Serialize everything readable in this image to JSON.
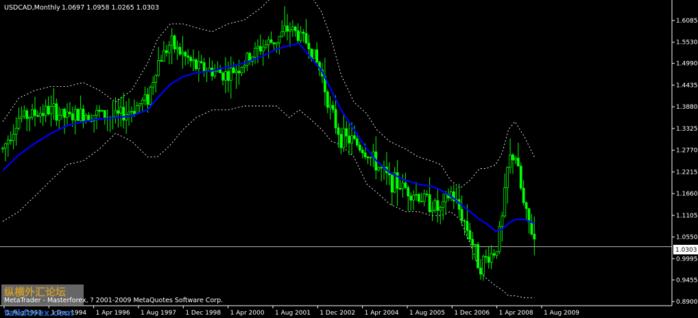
{
  "header": {
    "symbol_tf": "USDCAD,Monthly",
    "ohlc": "1.0697 1.0958 1.0265 1.0303"
  },
  "footer": {
    "copyright": "MetaTrader - Masterforex, ? 2001-2009 MetaQuotes Software Corp.",
    "watermark_cn": "纵横外汇论坛",
    "watermark_site": "talkforex.com"
  },
  "colors": {
    "background": "#000000",
    "axis": "#ffffff",
    "candles": "#00ff00",
    "ma": "#0000ff",
    "bands": "#ffffff",
    "price_line": "#ffffff",
    "current_label_bg": "#ffffff"
  },
  "chart_data": {
    "type": "line",
    "subtype": "candlestick with moving average and envelope bands",
    "title": "USDCAD,Monthly",
    "current_price": 1.0303,
    "price_axis": {
      "ticks": [
        "1.6085",
        "1.5530",
        "1.4990",
        "1.4435",
        "1.3880",
        "1.3325",
        "1.2770",
        "1.2215",
        "1.1660",
        "1.1105",
        "1.0550",
        "0.9995",
        "0.9455",
        "0.8900"
      ],
      "current_label": "1.0303"
    },
    "time_axis": {
      "ticks": [
        "1 Aug 1993",
        "1 Dec 1994",
        "1 Apr 1996",
        "1 Aug 1997",
        "1 Dec 1998",
        "1 Apr 2000",
        "1 Aug 2001",
        "1 Dec 2002",
        "1 Apr 2004",
        "1 Aug 2005",
        "1 Dec 2006",
        "1 Apr 2008",
        "1 Aug 2009"
      ]
    },
    "ylim": [
      0.89,
      1.6085
    ],
    "x": [
      1993.0,
      1993.5,
      1994.0,
      1994.5,
      1995.0,
      1995.5,
      1996.0,
      1996.5,
      1997.0,
      1997.5,
      1997.8,
      1998.2,
      1998.6,
      1999.0,
      1999.5,
      2000.0,
      2000.5,
      2001.0,
      2001.5,
      2001.9,
      2002.2,
      2002.5,
      2002.9,
      2003.2,
      2003.5,
      2003.9,
      2004.3,
      2004.6,
      2005.0,
      2005.5,
      2005.9,
      2006.3,
      2006.6,
      2006.9,
      2007.2,
      2007.5,
      2007.8,
      2008.0,
      2008.3,
      2008.5,
      2008.7,
      2008.9,
      2009.2,
      2009.5
    ],
    "series": [
      {
        "values": [
          1.28,
          1.36,
          1.37,
          1.38,
          1.36,
          1.37,
          1.37,
          1.36,
          1.38,
          1.41,
          1.5,
          1.55,
          1.52,
          1.49,
          1.48,
          1.47,
          1.5,
          1.54,
          1.56,
          1.59,
          1.57,
          1.55,
          1.47,
          1.37,
          1.31,
          1.3,
          1.27,
          1.24,
          1.2,
          1.18,
          1.16,
          1.14,
          1.12,
          1.17,
          1.12,
          1.06,
          0.98,
          1.0,
          1.02,
          1.1,
          1.25,
          1.27,
          1.12,
          1.05
        ]
      },
      {
        "values": [
          1.225,
          1.265,
          1.295,
          1.32,
          1.34,
          1.35,
          1.357,
          1.36,
          1.365,
          1.38,
          1.41,
          1.445,
          1.465,
          1.475,
          1.48,
          1.49,
          1.5,
          1.515,
          1.535,
          1.545,
          1.55,
          1.52,
          1.48,
          1.43,
          1.38,
          1.33,
          1.28,
          1.25,
          1.22,
          1.2,
          1.19,
          1.185,
          1.175,
          1.16,
          1.14,
          1.12,
          1.1,
          1.09,
          1.07,
          1.075,
          1.09,
          1.1,
          1.1,
          1.09
        ]
      },
      {
        "values": [
          1.35,
          1.41,
          1.43,
          1.44,
          1.44,
          1.45,
          1.43,
          1.4,
          1.43,
          1.5,
          1.56,
          1.6,
          1.6,
          1.59,
          1.58,
          1.6,
          1.61,
          1.64,
          1.68,
          1.73,
          1.72,
          1.68,
          1.63,
          1.56,
          1.47,
          1.4,
          1.37,
          1.33,
          1.3,
          1.28,
          1.26,
          1.25,
          1.24,
          1.2,
          1.18,
          1.2,
          1.23,
          1.23,
          1.24,
          1.27,
          1.33,
          1.35,
          1.31,
          1.26
        ]
      },
      {
        "values": [
          1.095,
          1.12,
          1.16,
          1.2,
          1.24,
          1.25,
          1.28,
          1.32,
          1.3,
          1.26,
          1.26,
          1.29,
          1.33,
          1.36,
          1.38,
          1.38,
          1.39,
          1.39,
          1.39,
          1.36,
          1.38,
          1.36,
          1.33,
          1.3,
          1.29,
          1.26,
          1.19,
          1.17,
          1.14,
          1.12,
          1.12,
          1.11,
          1.11,
          1.12,
          1.1,
          1.04,
          0.97,
          0.95,
          0.93,
          0.92,
          0.905,
          0.905,
          0.9,
          0.9
        ]
      }
    ]
  }
}
